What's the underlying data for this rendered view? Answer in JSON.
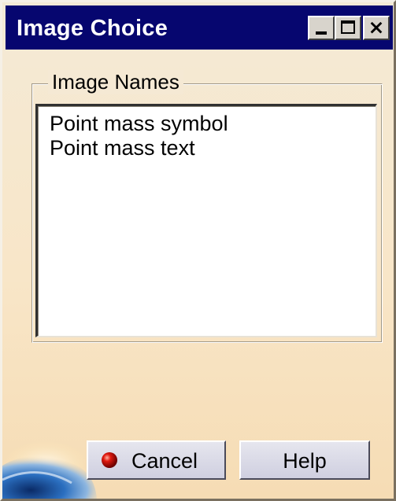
{
  "window": {
    "title": "Image Choice",
    "title_bar_color": "#06066f",
    "controls": {
      "minimize_icon": "minimize-icon",
      "maximize_icon": "maximize-icon",
      "close_icon": "close-icon",
      "close_glyph": "×"
    }
  },
  "image_names": {
    "group_label": "Image Names",
    "items": [
      "Point mass symbol",
      "Point mass text"
    ]
  },
  "buttons": {
    "cancel_label": "Cancel",
    "cancel_icon": "red-ball-icon",
    "help_label": "Help"
  },
  "colors": {
    "dialog_background": "#f6e4c4",
    "cancel_icon_color": "#d40000"
  }
}
